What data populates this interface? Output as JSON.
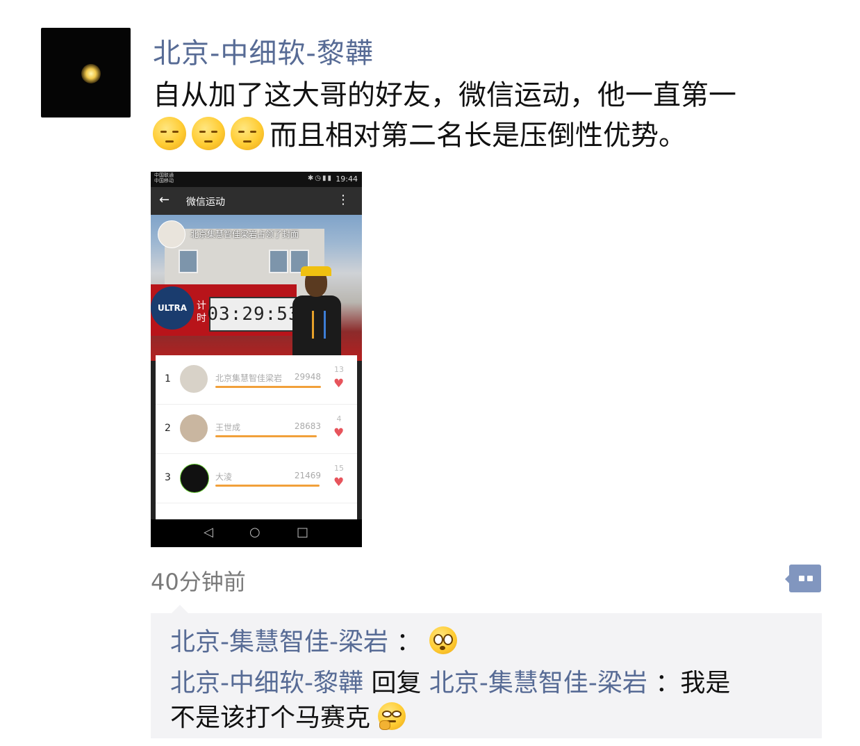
{
  "post": {
    "author": "北京-中细软-黎韡",
    "text_line1": "自从加了这大哥的好友，微信运动，他一直第一",
    "text_line2": "而且相对第二名长是压倒性优势。",
    "emojis": [
      "pensive-face",
      "pensive-face",
      "pensive-face"
    ],
    "timestamp": "40分钟前"
  },
  "screenshot": {
    "status": {
      "carrier1": "中国联通",
      "carrier2": "中国移动",
      "time": "19:44"
    },
    "appbar_title": "微信运动",
    "cover_caption": "北京集慧智佳梁岩占领了封面",
    "scoreboard": {
      "logo_text": "ULTRA",
      "timer_label": "计时",
      "timer": "03:29:53"
    },
    "ranking": [
      {
        "rank": "1",
        "name": "北京集慧智佳梁岩",
        "steps": "29948",
        "likes": "13"
      },
      {
        "rank": "2",
        "name": "王世成",
        "steps": "28683",
        "likes": "4"
      },
      {
        "rank": "3",
        "name": "大淩",
        "steps": "21469",
        "likes": "15"
      }
    ]
  },
  "comments": {
    "c1_author": "北京-集慧智佳-梁岩",
    "c1_sep": "：",
    "c2_author": "北京-中细软-黎韡",
    "c2_reply": "回复",
    "c2_target": "北京-集慧智佳-梁岩",
    "c2_text1": "：我是",
    "c2_text2": "不是该打个马赛克"
  },
  "colors": {
    "nickname": "#576b95",
    "comment_bg": "#f3f3f5",
    "timestamp": "#7a7a7a"
  }
}
